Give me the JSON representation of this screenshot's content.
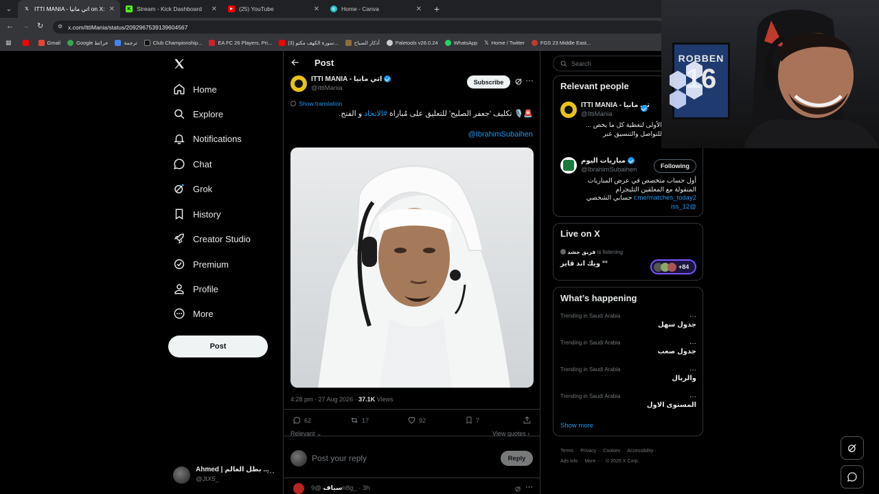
{
  "browser": {
    "tabs": [
      {
        "title": "ITTI MANIA - اتي مانيا on X: \"🚨",
        "favicon": "x-icon",
        "active": true
      },
      {
        "title": "Stream - Kick Dashboard",
        "favicon": "kick-icon",
        "active": false
      },
      {
        "title": "(25) YouTube",
        "favicon": "youtube-icon",
        "active": false
      },
      {
        "title": "Home - Canva",
        "favicon": "canva-icon",
        "active": false
      }
    ],
    "url": "x.com/IttiMania/status/2092967539139604567",
    "bookmarks": [
      "Gmail",
      "Google خرائط",
      "ترجمة",
      "Club Championship...",
      "EA FC 26 Players, Pri...",
      "(3) سورة الكهف مكتو...",
      "أذكار الصباح",
      "Paletools v26.0.24",
      "WhatsApp",
      "Home / Twitter",
      "FGS 23 Middle East..."
    ]
  },
  "nav": {
    "items": [
      {
        "label": "Home",
        "icon": "home-icon"
      },
      {
        "label": "Explore",
        "icon": "search-icon"
      },
      {
        "label": "Notifications",
        "icon": "bell-icon"
      },
      {
        "label": "Chat",
        "icon": "chat-icon"
      },
      {
        "label": "Grok",
        "icon": "grok-icon"
      },
      {
        "label": "History",
        "icon": "bookmark-icon"
      },
      {
        "label": "Creator Studio",
        "icon": "rocket-icon"
      },
      {
        "label": "Premium",
        "icon": "premium-icon"
      },
      {
        "label": "Profile",
        "icon": "person-icon"
      },
      {
        "label": "More",
        "icon": "more-circle-icon"
      }
    ],
    "post_label": "Post",
    "account": {
      "name": "Ahmed | بطل العالم ...",
      "handle": "@JtX5_"
    }
  },
  "post": {
    "header_title": "Post",
    "author_name": "ITTI MANIA - اتي مانيا",
    "author_handle": "@IttiMania",
    "subscribe_label": "Subscribe",
    "show_translation": "Show translation",
    "text_main": "🚨🎙️ تكليف 'جعفر الصليح' للتعليق على مُباراة ",
    "hashtag": "#الاتحاد",
    "text_end": " و الفتح.",
    "mention": "@IbrahimSubaihen",
    "time": "4:28 pm · 27 Aug 2026 · ",
    "views_count": "37.1K",
    "views_label": " Views",
    "stats": {
      "replies": "62",
      "reposts": "17",
      "likes": "92",
      "bookmarks": "7"
    },
    "relevant_label": "Relevant",
    "view_quotes_label": "View quotes",
    "reply_placeholder": "Post your reply",
    "reply_button": "Reply",
    "next_reply_name": "سياف",
    "next_reply_handle": "@9n8g_ · 3h"
  },
  "sidebar": {
    "search_placeholder": "Search",
    "relevant_title": "Relevant people",
    "people": [
      {
        "name": "ITTI MANIA - اتي مانيا",
        "handle": "@IttiMania",
        "bio": "الأولى لتغطية كل ما يخص ... للتواصل والتنسيق عبر"
      },
      {
        "name": "مباريات اليوم",
        "handle": "@IbrahimSubaihen",
        "follow_label": "Following",
        "bio_line1": "أول حساب متخصص في عرض المباريات",
        "bio_line2": "المنقولة مع المعلقين التليجرام",
        "bio_link": "t.me/matches_today2",
        "bio_line3": " حسابي الشخصي",
        "bio_handle": "@12_iss"
      }
    ],
    "live_title": "Live on X",
    "live_host": "فريق حشد",
    "live_status": " is listening",
    "live_space": "°° ويك اند قايز",
    "live_count": "+84",
    "happening_title": "What’s happening",
    "trends": [
      {
        "context": "Trending in Saudi Arabia",
        "topic": "جدول سهل"
      },
      {
        "context": "Trending in Saudi Arabia",
        "topic": "جدول صعب"
      },
      {
        "context": "Trending in Saudi Arabia",
        "topic": "والريال"
      },
      {
        "context": "Trending in Saudi Arabia",
        "topic": "المستوى الاول"
      }
    ],
    "show_more": "Show more",
    "footer_row1": [
      "Terms",
      "Privacy",
      "Cookies",
      "Accessibility"
    ],
    "footer_row2": [
      "Ads info",
      "More ···",
      "© 2026 X Corp."
    ]
  },
  "webcam": {
    "jersey_name": "ROBBEN",
    "jersey_number": "16"
  },
  "colors": {
    "accent": "#1d9bf0",
    "bg": "#000000",
    "border": "#2f3336",
    "muted": "#71767b"
  }
}
